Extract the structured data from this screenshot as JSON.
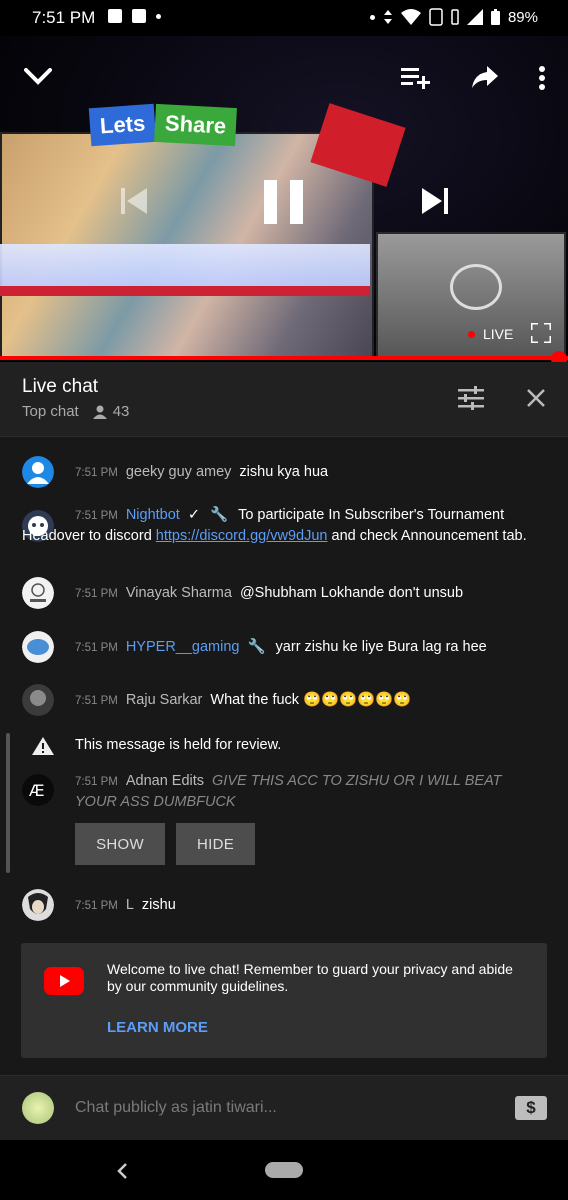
{
  "status_bar": {
    "time": "7:51 PM",
    "battery": "89%"
  },
  "player": {
    "badge_lets": "Lets",
    "badge_share": "Share",
    "live_label": "LIVE"
  },
  "chat_header": {
    "title": "Live chat",
    "mode": "Top chat",
    "viewers": "43"
  },
  "messages": [
    {
      "time": "7:51 PM",
      "author": "geeky guy amey",
      "text": "zishu kya hua"
    },
    {
      "time": "7:51 PM",
      "author": "Nightbot",
      "text": "To participate In Subscriber's Tournament Headover to discord",
      "link": "https://discord.gg/vw9dJun",
      "text_after": "and check Announcement tab."
    },
    {
      "time": "7:51 PM",
      "author": "Vinayak Sharma",
      "text": "@Shubham Lokhande don't unsub"
    },
    {
      "time": "7:51 PM",
      "author": "HYPER__gaming",
      "text": "yarr zishu ke liye Bura lag ra hee"
    },
    {
      "time": "7:51 PM",
      "author": "Raju Sarkar",
      "text": "What the fuck 🙄🙄🙄🙄🙄🙄"
    },
    {
      "notice": "This message is held for review.",
      "time": "7:51 PM",
      "author": "Adnan Edits",
      "text": "GIVE THIS ACC TO ZISHU OR I WILL BEAT YOUR ASS DUMBFUCK",
      "show_label": "SHOW",
      "hide_label": "HIDE"
    },
    {
      "time": "7:51 PM",
      "author": "L",
      "text": "zishu"
    }
  ],
  "welcome": {
    "text": "Welcome to live chat! Remember to guard your privacy and abide by our community guidelines.",
    "learn_more": "LEARN MORE"
  },
  "input": {
    "placeholder": "Chat publicly as jatin tiwari..."
  },
  "colors": {
    "accent_red": "#ff0000",
    "link_blue": "#5c9df5",
    "panel": "#212121",
    "chat_bg": "#181818"
  }
}
